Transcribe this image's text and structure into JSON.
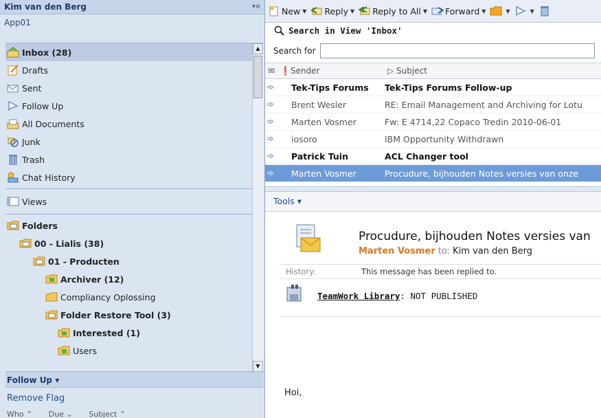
{
  "left": {
    "user_name": "Kim van den Berg",
    "app_name": "App01",
    "nav_items": [
      {
        "label": "Inbox (28)",
        "icon": "inbox-icon",
        "selected": true
      },
      {
        "label": "Drafts",
        "icon": "drafts-icon"
      },
      {
        "label": "Sent",
        "icon": "sent-icon"
      },
      {
        "label": "Follow Up",
        "icon": "flag-icon"
      },
      {
        "label": "All Documents",
        "icon": "all-documents-icon"
      },
      {
        "label": "Junk",
        "icon": "junk-icon"
      },
      {
        "label": "Trash",
        "icon": "trash-icon"
      },
      {
        "label": "Chat History",
        "icon": "chat-history-icon"
      }
    ],
    "views_label": "Views",
    "folders_label": "Folders",
    "folders": [
      {
        "label": "00 - Lialis (38)",
        "bold": true
      },
      {
        "label": "01 - Producten",
        "bold": true
      },
      {
        "label": "Archiver (12)",
        "bold": true
      },
      {
        "label": "Compliancy Oplossing",
        "bold": false
      },
      {
        "label": "Folder Restore Tool (3)",
        "bold": true
      },
      {
        "label": "Interested (1)",
        "bold": true
      },
      {
        "label": "Users",
        "bold": false
      }
    ],
    "follow_up": {
      "header": "Follow Up ▾",
      "remove_flag": "Remove Flag",
      "columns": [
        "Who ⌃",
        "Due ⌄",
        "Subject ⌃"
      ]
    }
  },
  "toolbar": {
    "new": "New",
    "reply": "Reply",
    "reply_all": "Reply to All",
    "forward": "Forward"
  },
  "search": {
    "title": "Search in View 'Inbox'",
    "label": "Search for",
    "value": ""
  },
  "view": {
    "col_sender": "Sender",
    "col_subject": "Subject",
    "rows": [
      {
        "sender": "Tek-Tips Forums",
        "subject": "Tek-Tips Forums Follow-up",
        "unread": true
      },
      {
        "sender": "Brent Wesler",
        "subject": "RE: Email Management and Archiving for Lotu",
        "unread": false
      },
      {
        "sender": "Marten Vosmer",
        "subject": "Fw: E 4714,22 Copaco Tredin 2010-06-01",
        "unread": false
      },
      {
        "sender": "iosoro",
        "subject": "IBM Opportunity Withdrawn",
        "unread": false
      },
      {
        "sender": "Patrick Tuin",
        "subject": "ACL Changer tool",
        "unread": true
      },
      {
        "sender": "Marten Vosmer",
        "subject": "Procudure, bijhouden Notes versies van onze",
        "selected": true
      }
    ]
  },
  "preview": {
    "tools_label": "Tools ▾",
    "subject": "Procudure, bijhouden Notes versies van",
    "from": "Marten Vosmer",
    "to_label": "to:",
    "to": "Kim van den Berg",
    "history_label": "History:",
    "history_text": "This message has been replied to.",
    "teamwork_link": "TeamWork Library",
    "teamwork_status": ": NOT PUBLISHED",
    "body_start": "Hoi,"
  },
  "colors": {
    "accent": "#6c9bd9",
    "sender_orange": "#e0771a",
    "left_bg": "#dbe5f1"
  }
}
